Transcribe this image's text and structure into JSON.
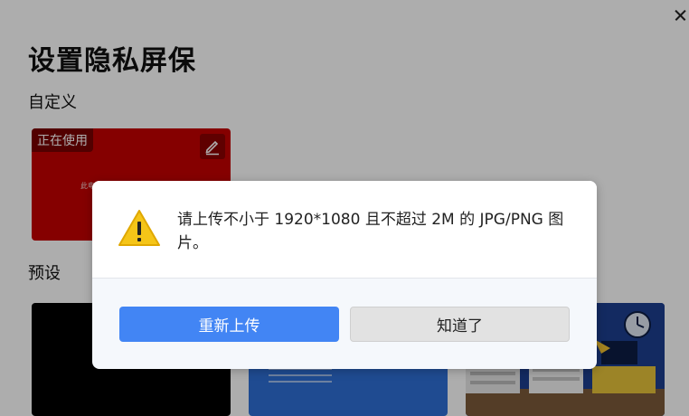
{
  "page": {
    "title": "设置隐私屏保",
    "custom_section_label": "自定义",
    "preset_section_label": "预设"
  },
  "custom_card": {
    "in_use_badge": "正在使用",
    "tiny_text": "此电"
  },
  "dialog": {
    "message": "请上传不小于 1920*1080 且不超过 2M 的 JPG/PNG 图片。",
    "primary_button": "重新上传",
    "secondary_button": "知道了"
  },
  "colors": {
    "accent": "#4285f4",
    "custom_card_bg": "#c40000",
    "warning": "#f5c518"
  }
}
